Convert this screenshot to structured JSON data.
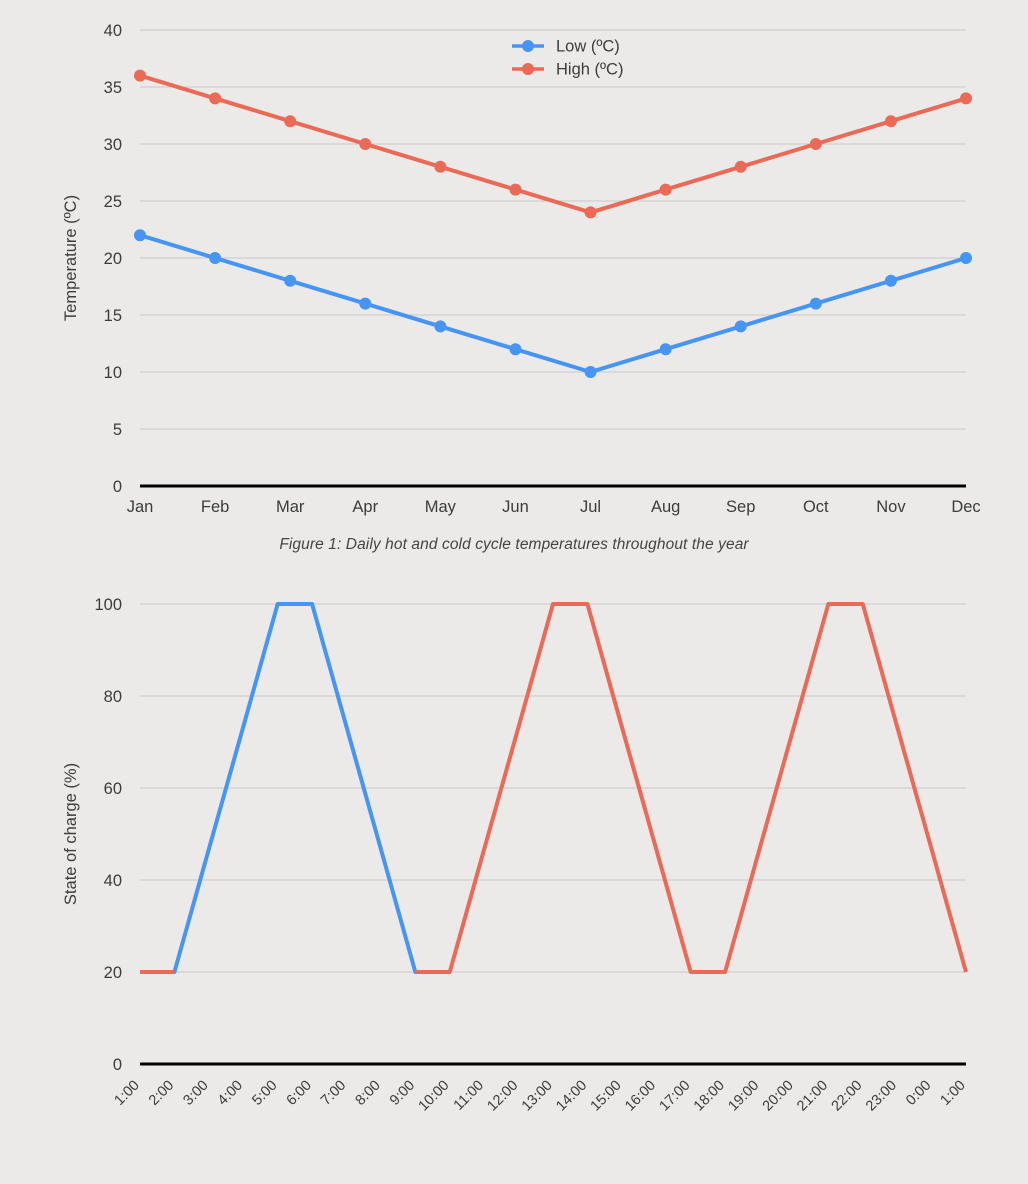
{
  "page": {
    "background_color": "#ebeae8",
    "text_color": "#3c3c3c"
  },
  "palette": {
    "low_series_color": "#4695f5",
    "high_series_color": "#ea6a57",
    "gridline_color": "#c9c8c6",
    "axis_color": "#000000"
  },
  "figure1": {
    "caption": "Figure 1: Daily hot and cold cycle temperatures throughout the year",
    "legend": {
      "position": "top-center",
      "entries": [
        {
          "label": "Low (ºC)",
          "color": "#4695f5"
        },
        {
          "label": "High (ºC)",
          "color": "#ea6a57"
        }
      ]
    }
  },
  "figure2": {
    "caption": ""
  },
  "chart_data": [
    {
      "id": "temperature-chart",
      "type": "line",
      "title": "",
      "xlabel": "",
      "ylabel": "Temperature (ºC)",
      "categories": [
        "Jan",
        "Feb",
        "Mar",
        "Apr",
        "May",
        "Jun",
        "Jul",
        "Aug",
        "Sep",
        "Oct",
        "Nov",
        "Dec"
      ],
      "ylim": [
        0,
        40
      ],
      "yticks": [
        0,
        5,
        10,
        15,
        20,
        25,
        30,
        35,
        40
      ],
      "ytick_labels": [
        "0",
        "5",
        "10",
        "15",
        "20",
        "25",
        "30",
        "35",
        "40"
      ],
      "grid": true,
      "markers": true,
      "legend": [
        "Low (ºC)",
        "High (ºC)"
      ],
      "series": [
        {
          "name": "Low (ºC)",
          "color": "#4695f5",
          "values": [
            22,
            20,
            18,
            16,
            14,
            12,
            10,
            12,
            14,
            16,
            18,
            20
          ]
        },
        {
          "name": "High (ºC)",
          "color": "#ea6a57",
          "values": [
            36,
            34,
            32,
            30,
            28,
            26,
            24,
            26,
            28,
            30,
            32,
            34
          ]
        }
      ]
    },
    {
      "id": "state-of-charge-chart",
      "type": "line",
      "title": "",
      "xlabel": "",
      "ylabel": "State of charge (%)",
      "categories": [
        "1:00",
        "2:00",
        "3:00",
        "4:00",
        "5:00",
        "6:00",
        "7:00",
        "8:00",
        "9:00",
        "10:00",
        "11:00",
        "12:00",
        "13:00",
        "14:00",
        "15:00",
        "16:00",
        "17:00",
        "18:00",
        "19:00",
        "20:00",
        "21:00",
        "22:00",
        "23:00",
        "0:00",
        "1:00"
      ],
      "ylim": [
        0,
        100
      ],
      "yticks": [
        0,
        20,
        40,
        60,
        80,
        100
      ],
      "ytick_labels": [
        "0",
        "20",
        "40",
        "60",
        "80",
        "100"
      ],
      "grid": true,
      "markers": false,
      "xtick_rotation": -45,
      "series": [
        {
          "name": "charge-blue",
          "color": "#4695f5",
          "values": [
            20,
            20,
            46.7,
            73.3,
            100,
            100,
            73.3,
            46.7,
            20,
            20,
            null,
            null,
            null,
            null,
            null,
            null,
            null,
            null,
            null,
            null,
            null,
            null,
            null,
            null,
            null
          ]
        },
        {
          "name": "charge-red",
          "color": "#ea6a57",
          "values": [
            20,
            20,
            null,
            null,
            null,
            null,
            null,
            null,
            20,
            20,
            46.7,
            73.3,
            100,
            100,
            73.3,
            46.7,
            20,
            20,
            46.7,
            73.3,
            100,
            100,
            73.3,
            46.7,
            20
          ]
        }
      ]
    }
  ]
}
